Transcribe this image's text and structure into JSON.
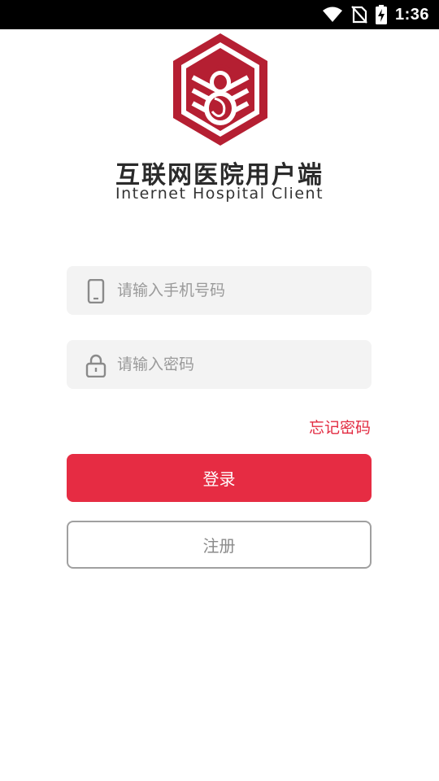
{
  "status_bar": {
    "time": "1:36",
    "icons": [
      "wifi-icon",
      "no-sim-icon",
      "battery-charging-icon"
    ]
  },
  "brand": {
    "title_cn": "互联网医院用户端",
    "title_en": "Internet Hospital Client",
    "logo_icon": "hospital-logo-icon",
    "logo_color": "#b51f32"
  },
  "form": {
    "phone_placeholder": "请输入手机号码",
    "phone_value": "",
    "phone_icon": "phone-icon",
    "password_placeholder": "请输入密码",
    "password_value": "",
    "password_icon": "lock-icon",
    "forgot_label": "忘记密码",
    "login_label": "登录",
    "register_label": "注册"
  },
  "colors": {
    "accent": "#e62c43",
    "field_bg": "#f3f3f3",
    "placeholder": "#9a9a9a"
  }
}
